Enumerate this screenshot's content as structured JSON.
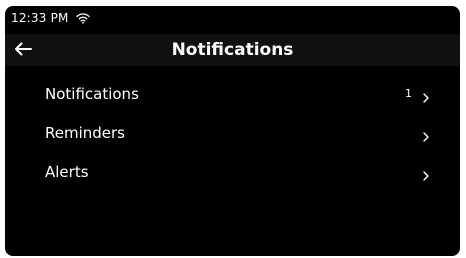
{
  "status_bar": {
    "time": "12:33 PM",
    "wifi_icon": "wifi-icon"
  },
  "header": {
    "back_icon": "back-arrow-icon",
    "title": "Notifications"
  },
  "menu": {
    "items": [
      {
        "label": "Notifications",
        "count": "1",
        "icon": "chevron-right-icon"
      },
      {
        "label": "Reminders",
        "count": "",
        "icon": "chevron-right-icon"
      },
      {
        "label": "Alerts",
        "count": "",
        "icon": "chevron-right-icon"
      }
    ]
  },
  "colors": {
    "background": "#000000",
    "header_background": "#111111",
    "text": "#ffffff"
  }
}
